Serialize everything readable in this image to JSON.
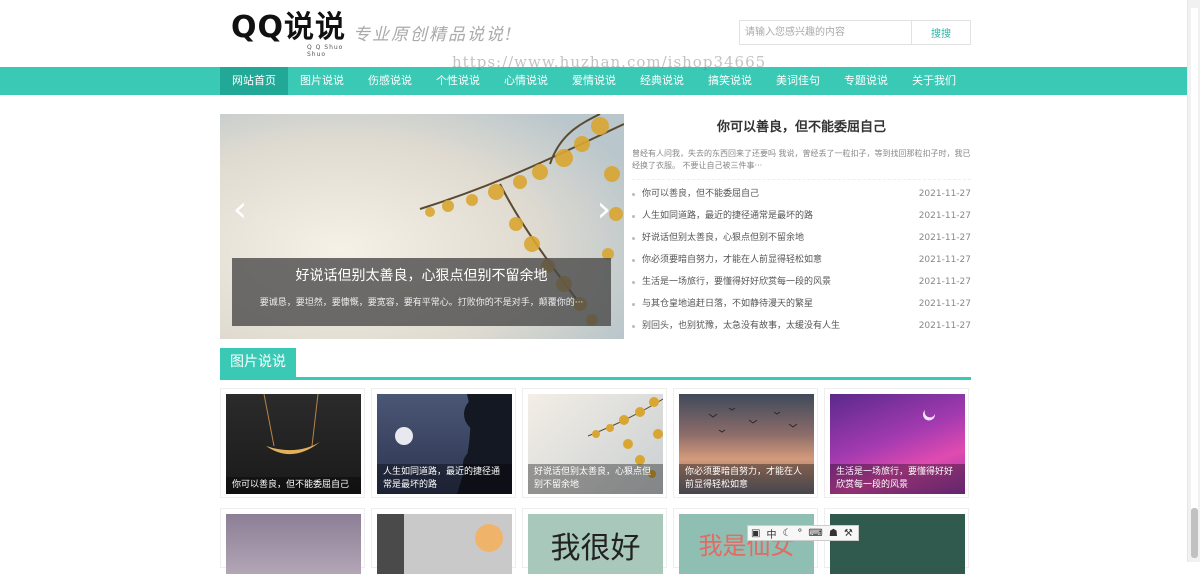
{
  "header": {
    "logo_text": "QQ说说",
    "logo_sub": "Q Q Shuo Shuo",
    "slogan": "专业原创精品说说!",
    "search_placeholder": "请输入您感兴趣的内容",
    "search_button": "搜搜"
  },
  "watermark": "https://www.huzhan.com/ishop34665",
  "nav": {
    "items": [
      {
        "label": "网站首页"
      },
      {
        "label": "图片说说"
      },
      {
        "label": "伤感说说"
      },
      {
        "label": "个性说说"
      },
      {
        "label": "心情说说"
      },
      {
        "label": "爱情说说"
      },
      {
        "label": "经典说说"
      },
      {
        "label": "搞笑说说"
      },
      {
        "label": "美词佳句"
      },
      {
        "label": "专题说说"
      },
      {
        "label": "关于我们"
      }
    ],
    "active_index": 0
  },
  "slider": {
    "caption_title": "好说话但别太善良，心狠点但别不留余地",
    "caption_desc": "要诚恳，要坦然，要慷慨，要宽容，要有平常心。打败你的不是对手，颠覆你的···",
    "prev_arrow": "‹",
    "next_arrow": "›"
  },
  "feature": {
    "title": "你可以善良，但不能委屈自己",
    "summary": "曾经有人问我，失去的东西回来了还要吗 我说，曾经丢了一粒扣子，等到找回那粒扣子时，我已经换了衣服。      不要让自己被三件事···"
  },
  "news": [
    {
      "title": "你可以善良，但不能委屈自己",
      "date": "2021-11-27"
    },
    {
      "title": "人生如同道路，最近的捷径通常是最坏的路",
      "date": "2021-11-27"
    },
    {
      "title": "好说话但别太善良，心狠点但别不留余地",
      "date": "2021-11-27"
    },
    {
      "title": "你必须要暗自努力，才能在人前显得轻松如意",
      "date": "2021-11-27"
    },
    {
      "title": "生活是一场旅行，要懂得好好欣赏每一段的风景",
      "date": "2021-11-27"
    },
    {
      "title": "与其仓皇地追赶日落，不如静待漫天的繁星",
      "date": "2021-11-27"
    },
    {
      "title": "别回头，也别犹豫，太急没有故事，太缓没有人生",
      "date": "2021-11-27"
    }
  ],
  "section": {
    "title": "图片说说"
  },
  "cards": [
    {
      "caption": "你可以善良，但不能委屈自己"
    },
    {
      "caption": "人生如同道路，最近的捷径通常是最坏的路"
    },
    {
      "caption": "好说话但别太善良，心狠点但别不留余地"
    },
    {
      "caption": "你必须要暗自努力，才能在人前显得轻松如意"
    },
    {
      "caption": "生活是一场旅行，要懂得好好欣赏每一段的风景"
    }
  ],
  "second_row_texts": {
    "c3": "我很好",
    "c4": "我是仙女"
  },
  "ime": {
    "mode": "中"
  },
  "colors": {
    "accent": "#39c9b5",
    "nav_active": "#22a896"
  }
}
